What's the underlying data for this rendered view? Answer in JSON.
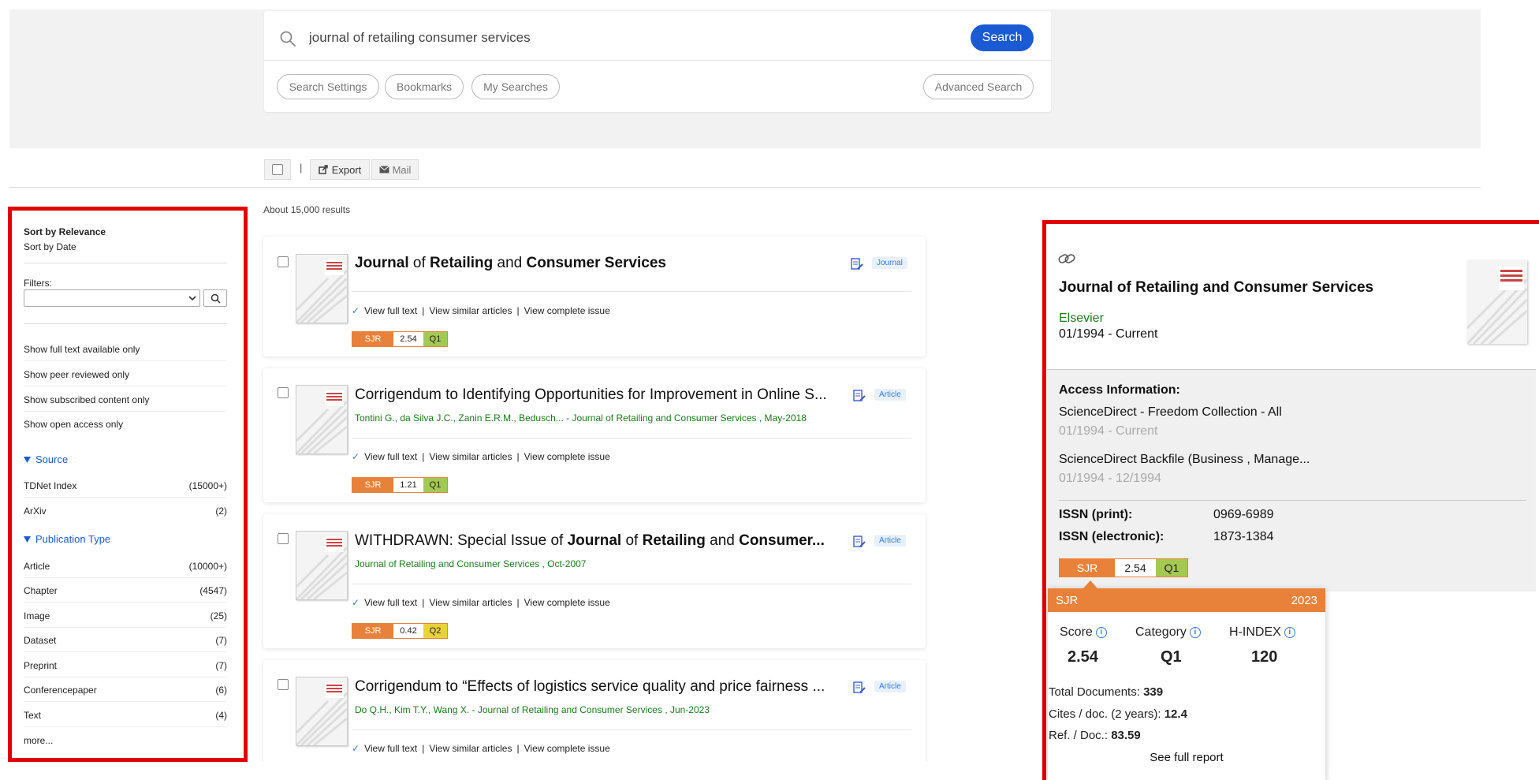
{
  "search": {
    "query": "journal of retailing consumer services",
    "button": "Search",
    "buttons": [
      "Search Settings",
      "Bookmarks",
      "My Searches"
    ],
    "advanced": "Advanced Search"
  },
  "toolbar": {
    "separator": "|",
    "export": "Export",
    "mail": "Mail"
  },
  "results_count": "About 15,000 results",
  "sidebar": {
    "sort_relevance": "Sort by Relevance",
    "sort_date": "Sort by Date",
    "filters_label": "Filters:",
    "toggles": [
      "Show full text available only",
      "Show peer reviewed only",
      "Show subscribed content only",
      "Show open access only"
    ],
    "source": {
      "title": "Source",
      "items": [
        {
          "label": "TDNet Index",
          "count": "(15000+)"
        },
        {
          "label": "ArXiv",
          "count": "(2)"
        }
      ]
    },
    "pubtype": {
      "title": "Publication Type",
      "items": [
        {
          "label": "Article",
          "count": "(10000+)"
        },
        {
          "label": "Chapter",
          "count": "(4547)"
        },
        {
          "label": "Image",
          "count": "(25)"
        },
        {
          "label": "Dataset",
          "count": "(7)"
        },
        {
          "label": "Preprint",
          "count": "(7)"
        },
        {
          "label": "Conferencepaper",
          "count": "(6)"
        },
        {
          "label": "Text",
          "count": "(4)"
        }
      ]
    },
    "more": "more..."
  },
  "results": [
    {
      "title": {
        "j": "Journal",
        "of": " of ",
        "r": "Retailing",
        "and": " and ",
        "c": "Consumer Services"
      },
      "meta": "",
      "type": "Journal",
      "sjr": {
        "label": "SJR",
        "score": "2.54",
        "quartile": "Q1"
      }
    },
    {
      "title": "Corrigendum to Identifying Opportunities for Improvement in Online S...",
      "meta": "Tontini G., da Silva J.C., Zanin E.R.M., Bedusch... - Journal of Retailing and Consumer Services , May-2018",
      "type": "Article",
      "sjr": {
        "label": "SJR",
        "score": "1.21",
        "quartile": "Q1"
      }
    },
    {
      "title": {
        "w": "WITHDRAWN: Special Issue of ",
        "j": "Journal",
        "of": " of ",
        "r": "Retailing",
        "and": " and ",
        "c": "Consumer..."
      },
      "meta": "Journal of Retailing and Consumer Services , Oct-2007",
      "type": "Article",
      "sjr": {
        "label": "SJR",
        "score": "0.42",
        "quartile": "Q2"
      }
    },
    {
      "title": "Corrigendum to “Effects of logistics service quality and price fairness ...",
      "meta": "Do Q.H., Kim T.Y., Wang X. - Journal of Retailing and Consumer Services , Jun-2023",
      "type": "Article"
    }
  ],
  "result_links": {
    "full": "View full text",
    "similar": "View similar articles",
    "issue": "View complete issue",
    "sep": "|"
  },
  "detail": {
    "title": "Journal of Retailing and Consumer Services",
    "publisher": "Elsevier",
    "coverage": "01/1994 - Current",
    "access_label": "Access Information:",
    "access": [
      {
        "name": "ScienceDirect - Freedom Collection - All",
        "range": "01/1994 - Current"
      },
      {
        "name": "ScienceDirect Backfile (Business , Manage...",
        "range": "01/1994 - 12/1994"
      }
    ],
    "issn_print_label": "ISSN (print):",
    "issn_print": "0969-6989",
    "issn_e_label": "ISSN (electronic):",
    "issn_e": "1873-1384",
    "sjr": {
      "label": "SJR",
      "score": "2.54",
      "quartile": "Q1"
    },
    "popup": {
      "label": "SJR",
      "year": "2023",
      "score_label": "Score",
      "category_label": "Category",
      "hindex_label": "H-INDEX",
      "score": "2.54",
      "category": "Q1",
      "hindex": "120",
      "total_docs_label": "Total Documents: ",
      "total_docs": "339",
      "cites_label": "Cites / doc. (2 years): ",
      "cites": "12.4",
      "ref_label": "Ref. / Doc.: ",
      "ref": "83.59",
      "full_report": "See full report"
    }
  },
  "colors": {
    "accent": "#1a5bd4",
    "sjr": "#e8823a",
    "q1": "#a5c853",
    "q2": "#e8d23a",
    "highlight": "#e00000",
    "publisher": "#1a7a1a"
  }
}
